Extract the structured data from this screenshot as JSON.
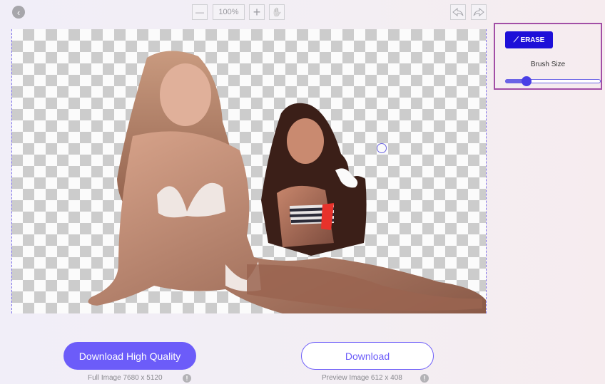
{
  "toolbar": {
    "back_icon": "chevron-left-icon",
    "back_glyph": "‹",
    "zoom_out_glyph": "—",
    "zoom_level": "100%",
    "zoom_in_glyph": "+",
    "pan_glyph": "✋",
    "undo_glyph": "⬅",
    "redo_glyph": "➡"
  },
  "editor": {
    "image_description": "Background-removed photo of two women in bikinis sitting, shown over a transparency checkerboard",
    "brush_cursor_icon": "brush-cursor-circle"
  },
  "side_panel": {
    "erase_label": "ERASE",
    "erase_icon_glyph": "⟋",
    "brush_size_label": "Brush Size",
    "brush_size_fraction": 0.22
  },
  "colors": {
    "accent": "#6c5cf9",
    "erase_button": "#1d0fd8",
    "panel_border": "#a24ea6",
    "canvas_border": "#7b6fe8"
  },
  "downloads": {
    "high_quality_label": "Download High Quality",
    "high_quality_caption": "Full Image 7680 x 5120",
    "preview_label": "Download",
    "preview_caption": "Preview Image 612 x 408",
    "info_glyph": "!"
  }
}
